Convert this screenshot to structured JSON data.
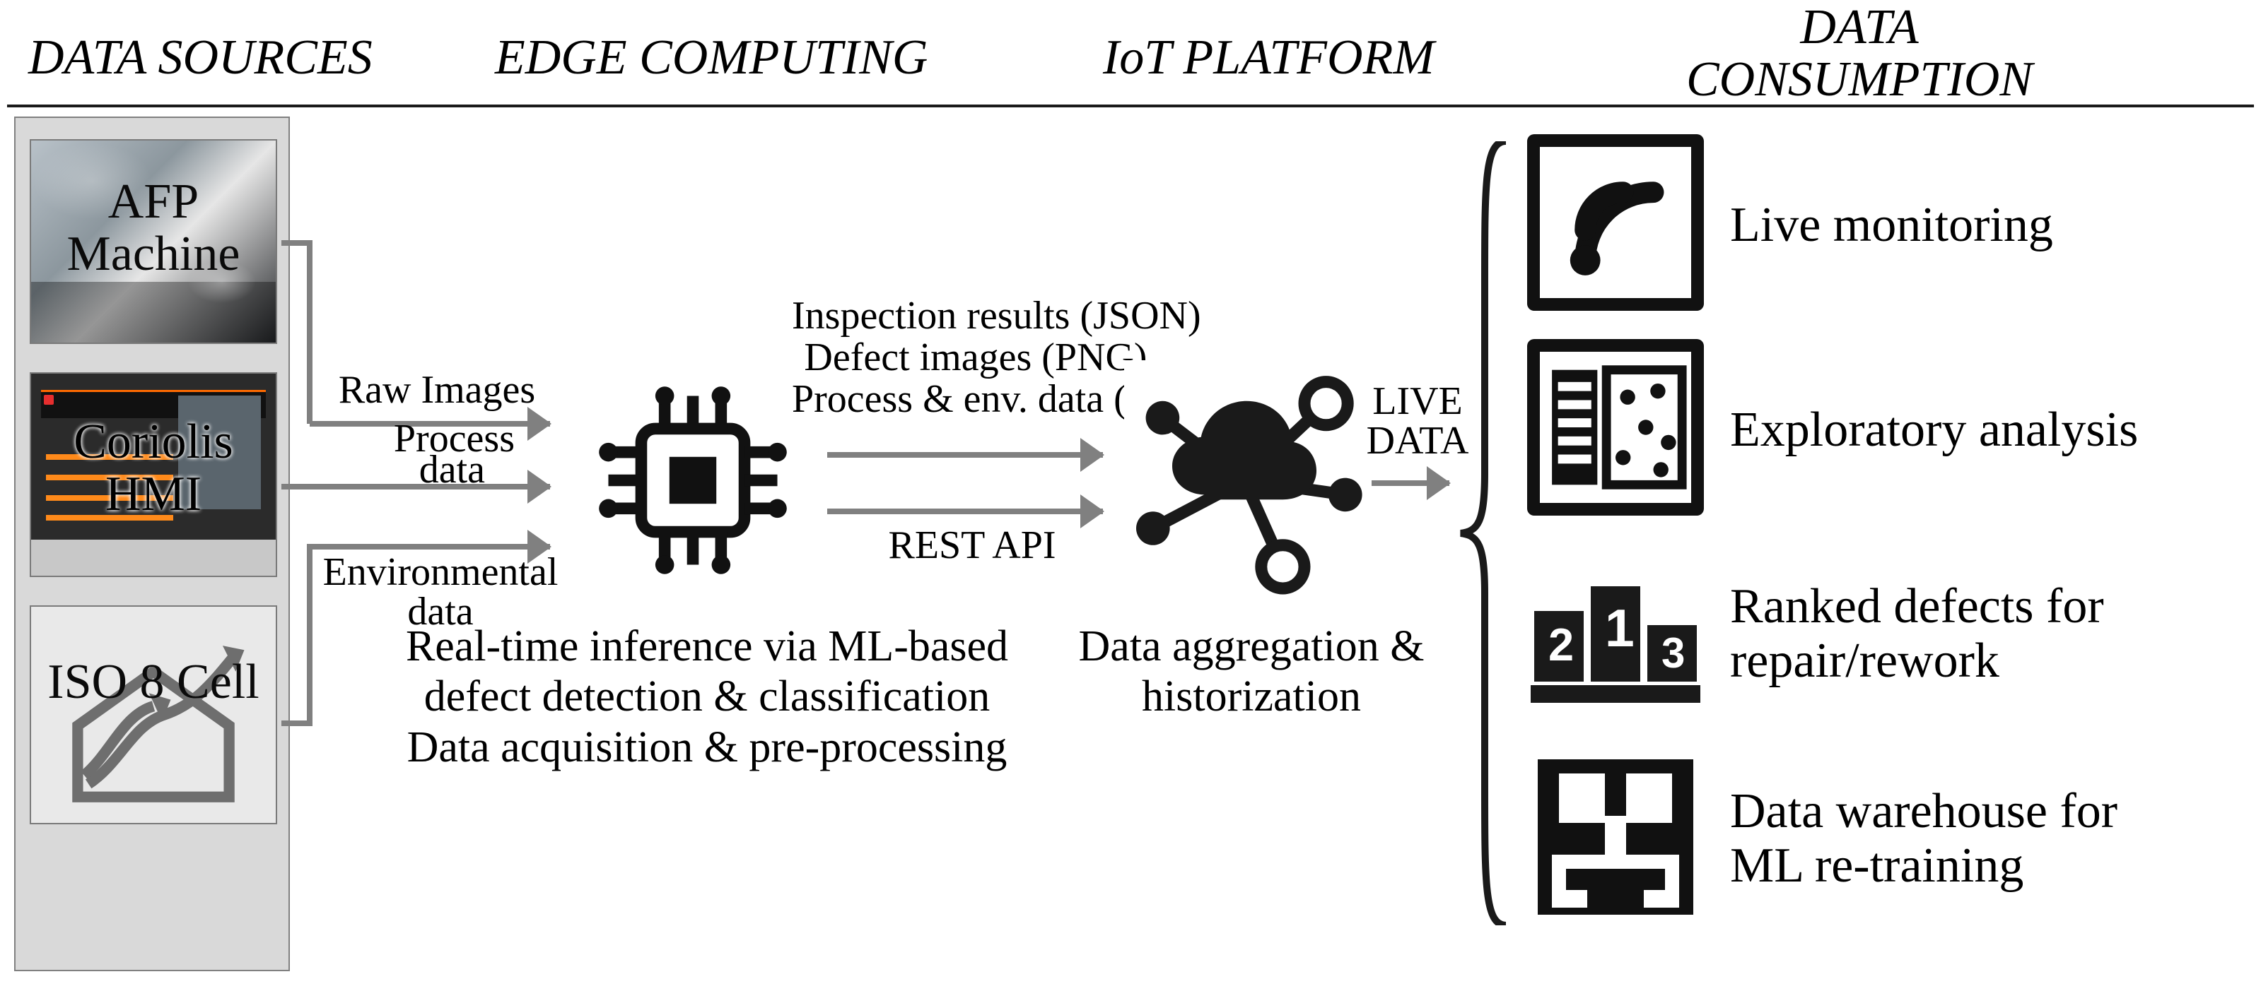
{
  "header": {
    "col1": "DATA SOURCES",
    "col2": "EDGE COMPUTING",
    "col3": "IoT PLATFORM",
    "col4": "DATA\nCONSUMPTION"
  },
  "sources": {
    "afp": {
      "label": "AFP\nMachine"
    },
    "hmi": {
      "label": "Coriolis\nHMI"
    },
    "iso": {
      "label": "ISO 8\nCell"
    }
  },
  "arrows": {
    "src_to_edge": [
      "Raw Images",
      "Process     \ndata        ",
      "Environmental\ndata"
    ],
    "edge_to_iot": "Inspection results (JSON)\nDefect images (PNG)\nProcess & env. data (JSON)",
    "iot_dir": "REST API",
    "iot_to_right": "LIVE\nDATA"
  },
  "edge": {
    "caption": "Real-time inference via ML-based\ndefect detection & classification\nData acquisition & pre-processing"
  },
  "iot": {
    "caption": "Data aggregation &\nhistorization"
  },
  "right": [
    {
      "title": "Live monitoring"
    },
    {
      "title": "Exploratory analysis"
    },
    {
      "title": "Ranked defects for\nrepair/rework"
    },
    {
      "title": "Data warehouse for\nML re-training"
    }
  ],
  "colors": {
    "grey": "#808080",
    "dark": "#1a1a1a"
  }
}
